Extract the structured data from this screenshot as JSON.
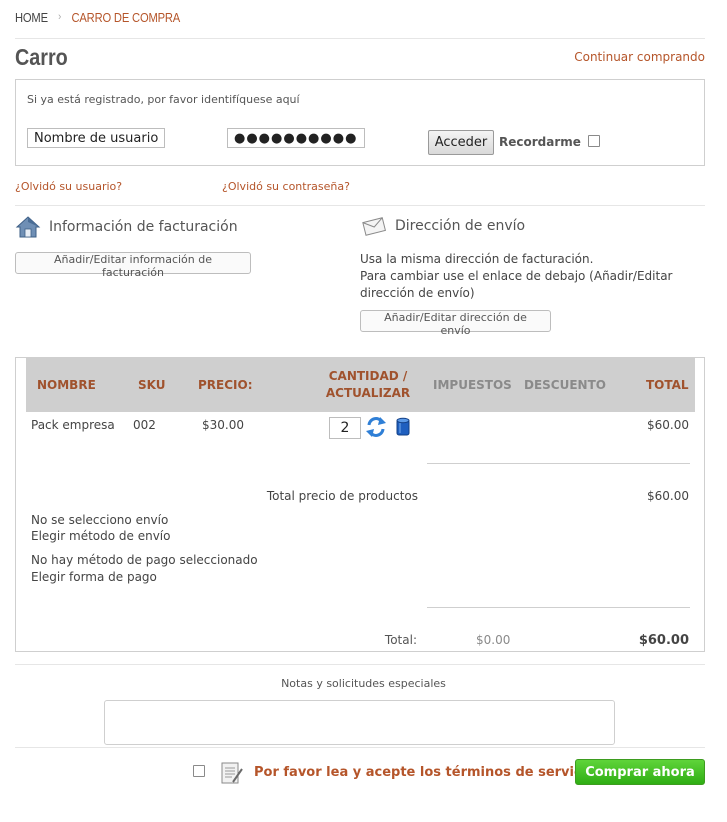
{
  "breadcrumb": {
    "home": "HOME",
    "separator": "›",
    "current": "CARRO DE COMPRA"
  },
  "page": {
    "title": "Carro",
    "continue_link": "Continuar comprando"
  },
  "login": {
    "hint": "Si ya está registrado, por favor identifíquese aquí",
    "username_value": "Nombre de usuario",
    "password_value": "●●●●●●●●●●",
    "submit_label": "Acceder",
    "remember_label": "Recordarme",
    "remember_checked": false
  },
  "forgot": {
    "username": "¿Olvidó su usuario?",
    "password": "¿Olvidó su contraseña?"
  },
  "billing": {
    "title": "Información de facturación",
    "button": "Añadir/Editar información de facturación",
    "icon": "house-icon"
  },
  "shipping": {
    "title": "Dirección de envío",
    "line1": "Usa la misma dirección de facturación.",
    "line2": "Para cambiar use el enlace de debajo (Añadir/Editar dirección de envío)",
    "button": "Añadir/Editar dirección de envío",
    "icon": "envelope-icon"
  },
  "cart": {
    "headers": {
      "name": "NOMBRE",
      "sku": "SKU",
      "price": "PRECIO:",
      "qty_line1": "CANTIDAD /",
      "qty_line2": "ACTUALIZAR",
      "tax": "IMPUESTOS",
      "discount": "DESCUENTO",
      "total": "TOTAL"
    },
    "items": [
      {
        "name": "Pack empresa",
        "sku": "002",
        "price": "$30.00",
        "quantity": "2",
        "total": "$60.00"
      }
    ],
    "products_total_label": "Total precio de productos",
    "products_total": "$60.00",
    "shipping_status": "No se selecciono envío",
    "shipping_link": "Elegir método de envío",
    "payment_status": "No hay método de pago seleccionado",
    "payment_link": "Elegir forma de pago",
    "total_label": "Total:",
    "total_tax": "$0.00",
    "grand_total": "$60.00"
  },
  "notes": {
    "label": "Notas y solicitudes especiales",
    "value": ""
  },
  "checkout": {
    "tos_text": "Por favor lea y acepte los términos de servicio.",
    "tos_checked": false,
    "buy_label": "Comprar ahora"
  },
  "colors": {
    "accent": "#b5552a",
    "buy_button": "#3cbf1c",
    "table_header_bg": "#cfcfcf"
  }
}
